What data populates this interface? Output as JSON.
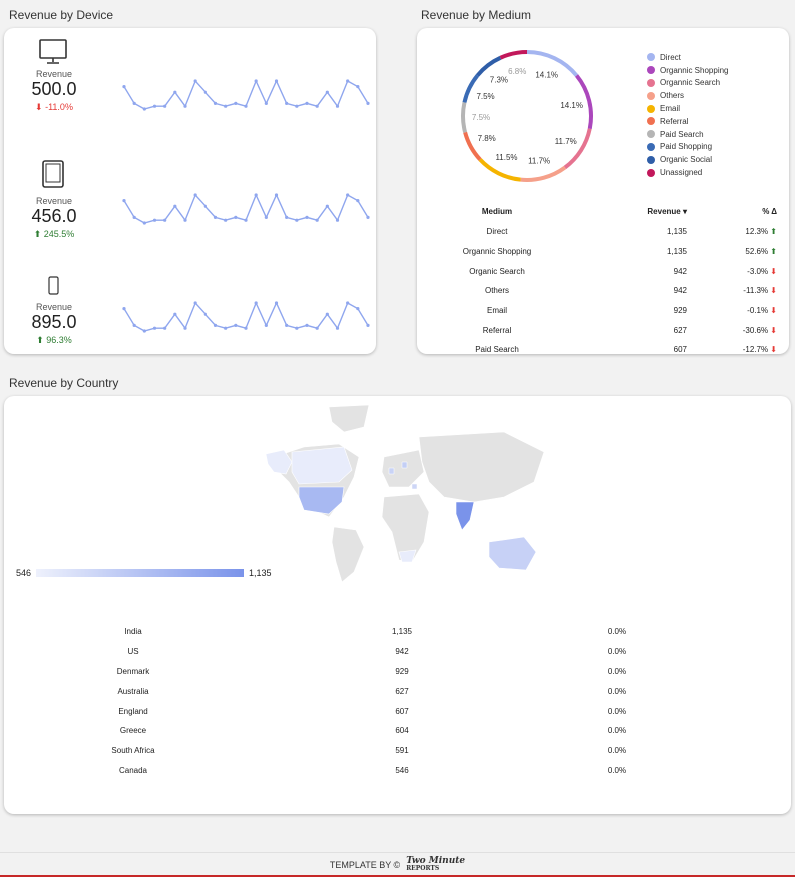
{
  "device_section": {
    "title": "Revenue by Device",
    "devices": [
      {
        "icon": "desktop-icon",
        "label": "Revenue",
        "value": "500.0",
        "delta": "-11.0%",
        "direction": "down",
        "spark": [
          6,
          3,
          2,
          2.5,
          2.5,
          5,
          2.5,
          7,
          5,
          3,
          2.5,
          3,
          2.5,
          7,
          3,
          7,
          3,
          2.5,
          3,
          2.5,
          5,
          2.5,
          7,
          6,
          3
        ]
      },
      {
        "icon": "tablet-icon",
        "label": "Revenue",
        "value": "456.0",
        "delta": "245.5%",
        "direction": "up",
        "spark": [
          6,
          3,
          2,
          2.5,
          2.5,
          5,
          2.5,
          7,
          5,
          3,
          2.5,
          3,
          2.5,
          7,
          3,
          7,
          3,
          2.5,
          3,
          2.5,
          5,
          2.5,
          7,
          6,
          3
        ]
      },
      {
        "icon": "phone-icon",
        "label": "Revenue",
        "value": "895.0",
        "delta": "96.3%",
        "direction": "up",
        "spark": [
          6,
          3,
          2,
          2.5,
          2.5,
          5,
          2.5,
          7,
          5,
          3,
          2.5,
          3,
          2.5,
          7,
          3,
          7,
          3,
          2.5,
          3,
          2.5,
          5,
          2.5,
          7,
          6,
          3
        ]
      }
    ]
  },
  "medium_section": {
    "title": "Revenue by Medium",
    "donut": [
      {
        "name": "Direct",
        "pct": 14.1,
        "label": "14.1%",
        "color": "#a4b5f0"
      },
      {
        "name": "Organnic Shopping",
        "pct": 14.1,
        "label": "14.1%",
        "color": "#ab47bc"
      },
      {
        "name": "Organnic Search",
        "pct": 11.7,
        "label": "11.7%",
        "color": "#e57390"
      },
      {
        "name": "Others",
        "pct": 11.7,
        "label": "11.7%",
        "color": "#f5a08a"
      },
      {
        "name": "Email",
        "pct": 11.5,
        "label": "11.5%",
        "color": "#f5b400"
      },
      {
        "name": "Referral",
        "pct": 7.8,
        "label": "7.8%",
        "color": "#f07050"
      },
      {
        "name": "Paid Search",
        "pct": 7.5,
        "label": "7.5%",
        "color": "#b5b5b5"
      },
      {
        "name": "Paid Shopping",
        "pct": 7.5,
        "label": "7.5%",
        "color": "#3a6bb5"
      },
      {
        "name": "Organic Social",
        "pct": 7.3,
        "label": "7.3%",
        "color": "#2f5ea8"
      },
      {
        "name": "Unassigned",
        "pct": 6.8,
        "label": "6.8%",
        "color": "#c2185b"
      }
    ],
    "table": {
      "headers": [
        "Medium",
        "Revenue ▾",
        "% Δ"
      ],
      "rows": [
        {
          "medium": "Direct",
          "revenue": "1,135",
          "delta": "12.3%",
          "dir": "up"
        },
        {
          "medium": "Organnic Shopping",
          "revenue": "1,135",
          "delta": "52.6%",
          "dir": "up"
        },
        {
          "medium": "Organic Search",
          "revenue": "942",
          "delta": "-3.0%",
          "dir": "down"
        },
        {
          "medium": "Others",
          "revenue": "942",
          "delta": "-11.3%",
          "dir": "down"
        },
        {
          "medium": "Email",
          "revenue": "929",
          "delta": "-0.1%",
          "dir": "down"
        },
        {
          "medium": "Referral",
          "revenue": "627",
          "delta": "-30.6%",
          "dir": "down"
        },
        {
          "medium": "Paid Search",
          "revenue": "607",
          "delta": "-12.7%",
          "dir": "down"
        }
      ]
    }
  },
  "country_section": {
    "title": "Revenue by Country",
    "scale_min": "546",
    "scale_max": "1,135",
    "rows": [
      {
        "country": "India",
        "revenue": "1,135",
        "delta": "0.0%"
      },
      {
        "country": "US",
        "revenue": "942",
        "delta": "0.0%"
      },
      {
        "country": "Denmark",
        "revenue": "929",
        "delta": "0.0%"
      },
      {
        "country": "Australia",
        "revenue": "627",
        "delta": "0.0%"
      },
      {
        "country": "England",
        "revenue": "607",
        "delta": "0.0%"
      },
      {
        "country": "Greece",
        "revenue": "604",
        "delta": "0.0%"
      },
      {
        "country": "South Africa",
        "revenue": "591",
        "delta": "0.0%"
      },
      {
        "country": "Canada",
        "revenue": "546",
        "delta": "0.0%"
      }
    ]
  },
  "footer": {
    "text": "TEMPLATE BY ©",
    "logo_line1": "Two Minute",
    "logo_line2": "REPORTS"
  },
  "colors": {
    "sparkline": "#8fa6ee",
    "map_base": "#e3e3e3",
    "map_high": "#7a93ea",
    "map_low": "#e8ecfb",
    "up": "#2e7d32",
    "down": "#e53935"
  }
}
